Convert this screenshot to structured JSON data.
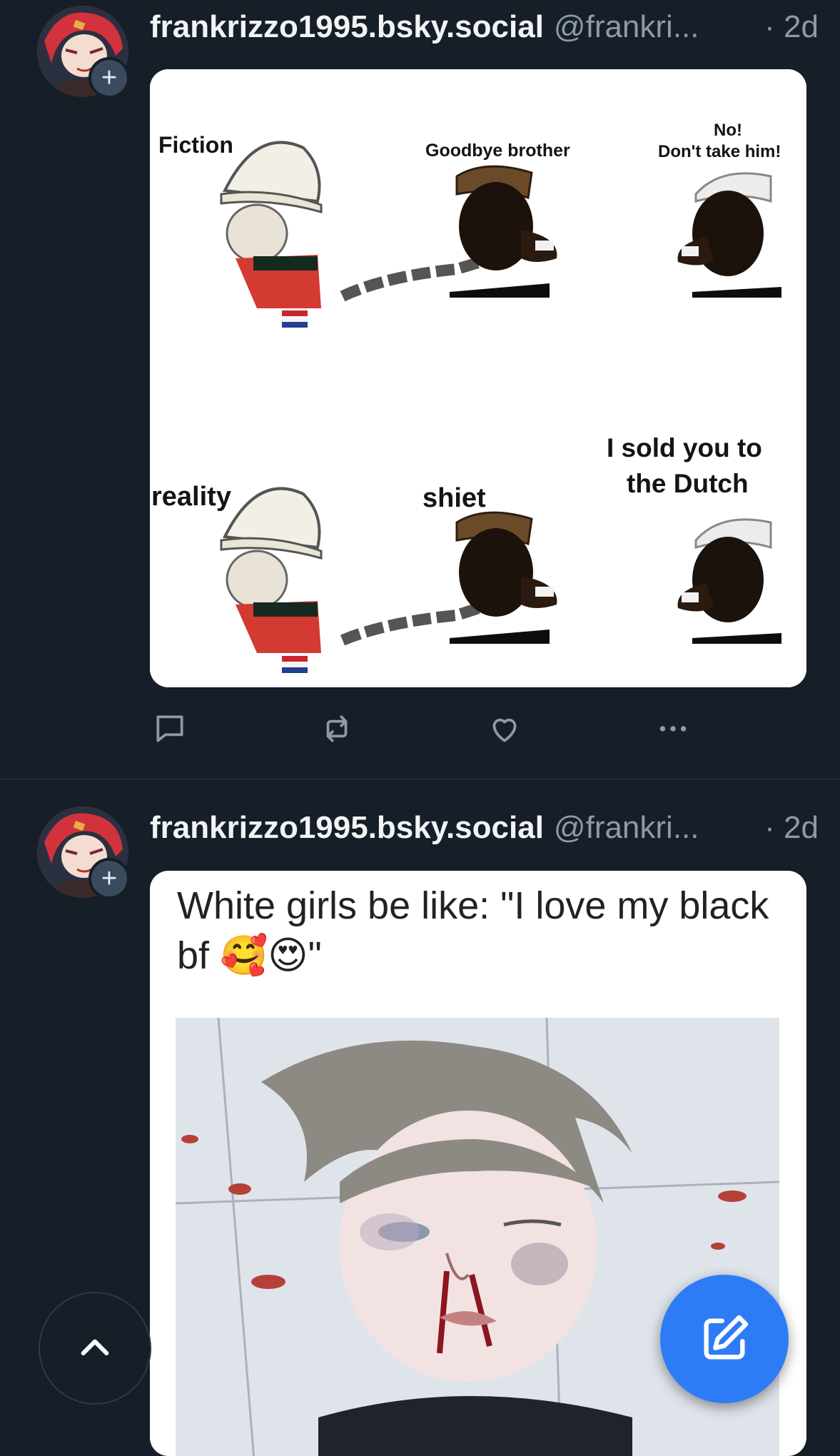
{
  "colors": {
    "background": "#161e27",
    "accent": "#2d7cf6",
    "muted_text": "#8d9aa8",
    "divider": "#2b3642"
  },
  "posts": [
    {
      "display_name": "frankrizzo1995.bsky.social",
      "handle": "@frankri...",
      "time": "· 2d",
      "meme_labels": {
        "fiction": "Fiction",
        "goodbye": "Goodbye brother",
        "no": "No!",
        "dont_take": "Don't take him!",
        "reality": "reality",
        "shiet": "shiet",
        "sold_1": "I sold you to",
        "sold_2": "the Dutch"
      }
    },
    {
      "display_name": "frankrizzo1995.bsky.social",
      "handle": "@frankri...",
      "time": "· 2d",
      "caption_line1": "White girls be like: \"I love my black",
      "caption_line2": "bf",
      "caption_emoji": "🥰😍",
      "caption_end": "\""
    }
  ],
  "icons": {
    "reply": "speech-bubble-icon",
    "repost": "repost-arrows-icon",
    "like": "heart-icon",
    "more": "ellipsis-icon",
    "follow": "plus-icon",
    "scroll_top": "chevron-up-icon",
    "compose": "pencil-square-icon"
  },
  "follow_glyph": "+"
}
